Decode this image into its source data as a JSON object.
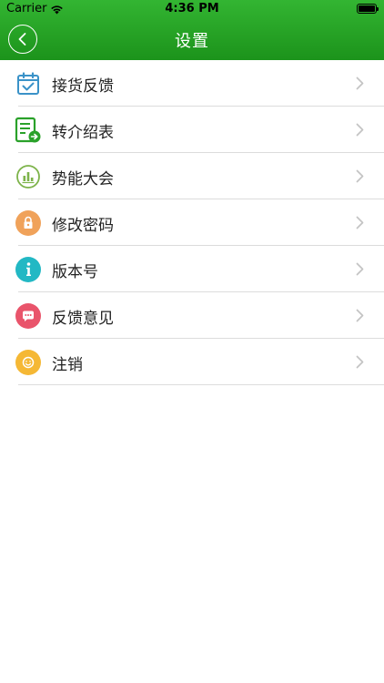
{
  "status_bar": {
    "carrier": "Carrier",
    "time": "4:36 PM"
  },
  "nav": {
    "title": "设置"
  },
  "menu": {
    "items": [
      {
        "label": "接货反馈",
        "icon": "calendar-check-icon"
      },
      {
        "label": "转介绍表",
        "icon": "form-arrow-icon"
      },
      {
        "label": "势能大会",
        "icon": "bar-chart-icon"
      },
      {
        "label": "修改密码",
        "icon": "lock-icon"
      },
      {
        "label": "版本号",
        "icon": "info-icon"
      },
      {
        "label": "反馈意见",
        "icon": "chat-bubble-icon"
      },
      {
        "label": "注销",
        "icon": "smiley-icon"
      }
    ]
  },
  "colors": {
    "header_green": "#1f9a1e",
    "calendar_blue": "#3a92c8",
    "form_green": "#2aa12a",
    "chart_green": "#7db34a",
    "lock_orange": "#f0a25a",
    "info_teal": "#22b8c4",
    "chat_red": "#e9546b",
    "smiley_yellow": "#f5b835"
  }
}
